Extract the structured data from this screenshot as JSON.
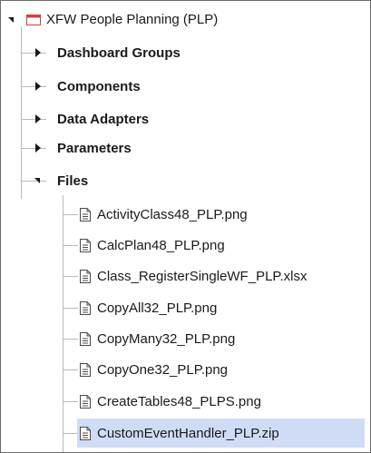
{
  "tree": {
    "root": {
      "label": "XFW People Planning  (PLP)",
      "icon": "folder-icon",
      "expanded": true,
      "accent": "#d0413a"
    },
    "groups": [
      {
        "label": "Dashboard Groups",
        "expanded": false
      },
      {
        "label": "Components",
        "expanded": false
      },
      {
        "label": "Data Adapters",
        "expanded": false
      },
      {
        "label": "Parameters",
        "expanded": false
      },
      {
        "label": "Files",
        "expanded": true
      }
    ],
    "files": [
      {
        "label": "ActivityClass48_PLP.png",
        "icon": "file-icon"
      },
      {
        "label": "CalcPlan48_PLP.png",
        "icon": "file-icon"
      },
      {
        "label": "Class_RegisterSingleWF_PLP.xlsx",
        "icon": "file-icon"
      },
      {
        "label": "CopyAll32_PLP.png",
        "icon": "file-icon"
      },
      {
        "label": "CopyMany32_PLP.png",
        "icon": "file-icon"
      },
      {
        "label": "CopyOne32_PLP.png",
        "icon": "file-icon"
      },
      {
        "label": "CreateTables48_PLPS.png",
        "icon": "file-icon"
      },
      {
        "label": "CustomEventHandler_PLP.zip",
        "icon": "file-icon",
        "selected": true
      }
    ],
    "colors": {
      "selection": "#cfdcf5",
      "guide_lines": "#b9b9b9",
      "text": "#1a1a1a"
    }
  }
}
